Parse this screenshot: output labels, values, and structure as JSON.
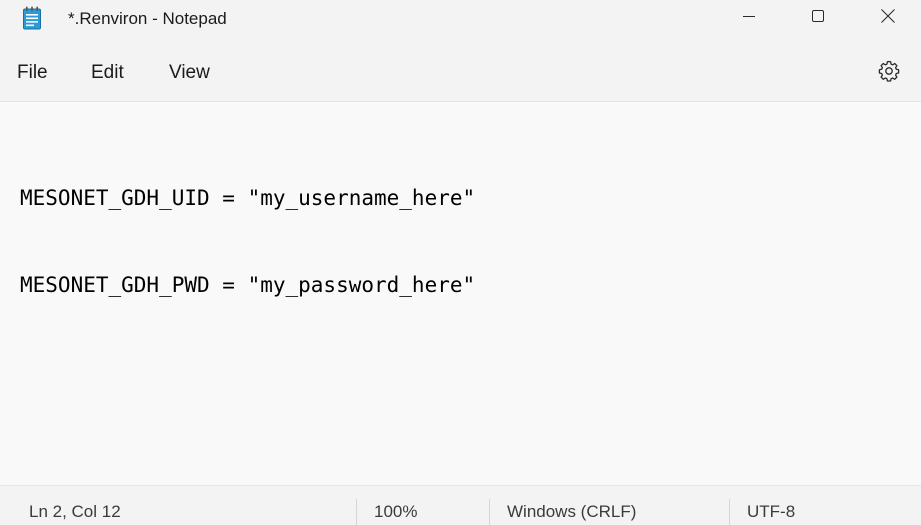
{
  "window": {
    "title": "*.Renviron - Notepad",
    "app_icon": "notepad-icon",
    "controls": {
      "minimize_icon": "minimize-icon",
      "maximize_icon": "maximize-icon",
      "close_icon": "close-icon"
    }
  },
  "menu": {
    "items": [
      {
        "label": "File"
      },
      {
        "label": "Edit"
      },
      {
        "label": "View"
      }
    ],
    "settings_icon": "gear-icon"
  },
  "editor": {
    "lines": [
      "MESONET_GDH_UID = \"my_username_here\"",
      "MESONET_GDH_PWD = \"my_password_here\""
    ]
  },
  "statusbar": {
    "position": "Ln 2, Col 12",
    "zoom": "100%",
    "line_ending": "Windows (CRLF)",
    "encoding": "UTF-8"
  },
  "colors": {
    "chrome_background": "#f3f3f3",
    "editor_background": "#f9f9f9",
    "icon_accent": "#2b9bd8"
  }
}
